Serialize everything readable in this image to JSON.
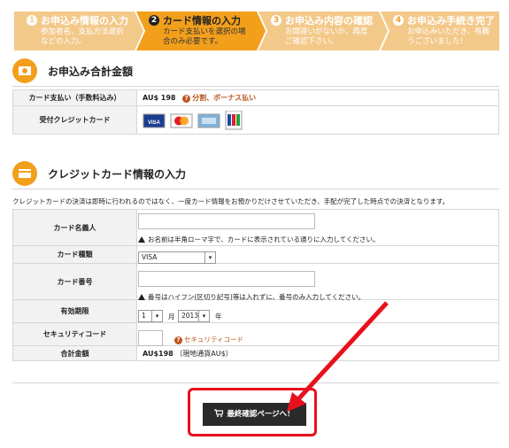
{
  "steps": [
    {
      "num": "1",
      "title": "お申込み情報の入力",
      "desc": "参加者名、支払方法選択\nなどの入力。",
      "state": "done"
    },
    {
      "num": "2",
      "title": "カード情報の入力",
      "desc": "カード支払いを選択の場\n合のみ必要です。",
      "state": "active"
    },
    {
      "num": "3",
      "title": "お申込み内容の確認",
      "desc": "お間違いがないか、再度\nご確認下さい。",
      "state": "inactive"
    },
    {
      "num": "4",
      "title": "お申込み手続き完了",
      "desc": "お申込みいただき、有難\nうございました！",
      "state": "inactive"
    }
  ],
  "summary": {
    "title": "お申込み合計金額",
    "rows": [
      {
        "label": "カード支払い（手数料込み）",
        "value": "AU$ 198",
        "link": "分割、ボーナス払い"
      },
      {
        "label": "受付クレジットカード"
      }
    ],
    "cards": [
      "VISA",
      "MasterCard",
      "AMEX",
      "JCB"
    ]
  },
  "card_form": {
    "title": "クレジットカード情報の入力",
    "note": "クレジットカードの決済は即時に行われるのではなく、一度カード情報をお預かりだけさせていただき、手配が完了した時点での決済となります。",
    "holder_label": "カード名義人",
    "holder_value": "",
    "holder_warn": "お名前は半角ローマ字で、カードに表示されている通りに入力してください。",
    "type_label": "カード種類",
    "type_value": "VISA",
    "number_label": "カード番号",
    "number_value": "",
    "number_warn": "番号はハイフン(区切り記号)等は入れずに、番号のみ入力してください。",
    "expiry_label": "有効期限",
    "expiry_month": "1",
    "month_unit": "月",
    "expiry_year": "2013",
    "year_unit": "年",
    "cvv_label": "セキュリティコード",
    "cvv_value": "",
    "cvv_link": "セキュリティコード",
    "total_label": "合計金額",
    "total_value": "AU$198",
    "total_note": "（現地通貨AU$）"
  },
  "submit_label": "最終確認ページへ！",
  "colors": {
    "accent": "#f29f1c",
    "step_done": "#f3c98a",
    "highlight": "#e8101c",
    "button": "#2a2a2a"
  }
}
